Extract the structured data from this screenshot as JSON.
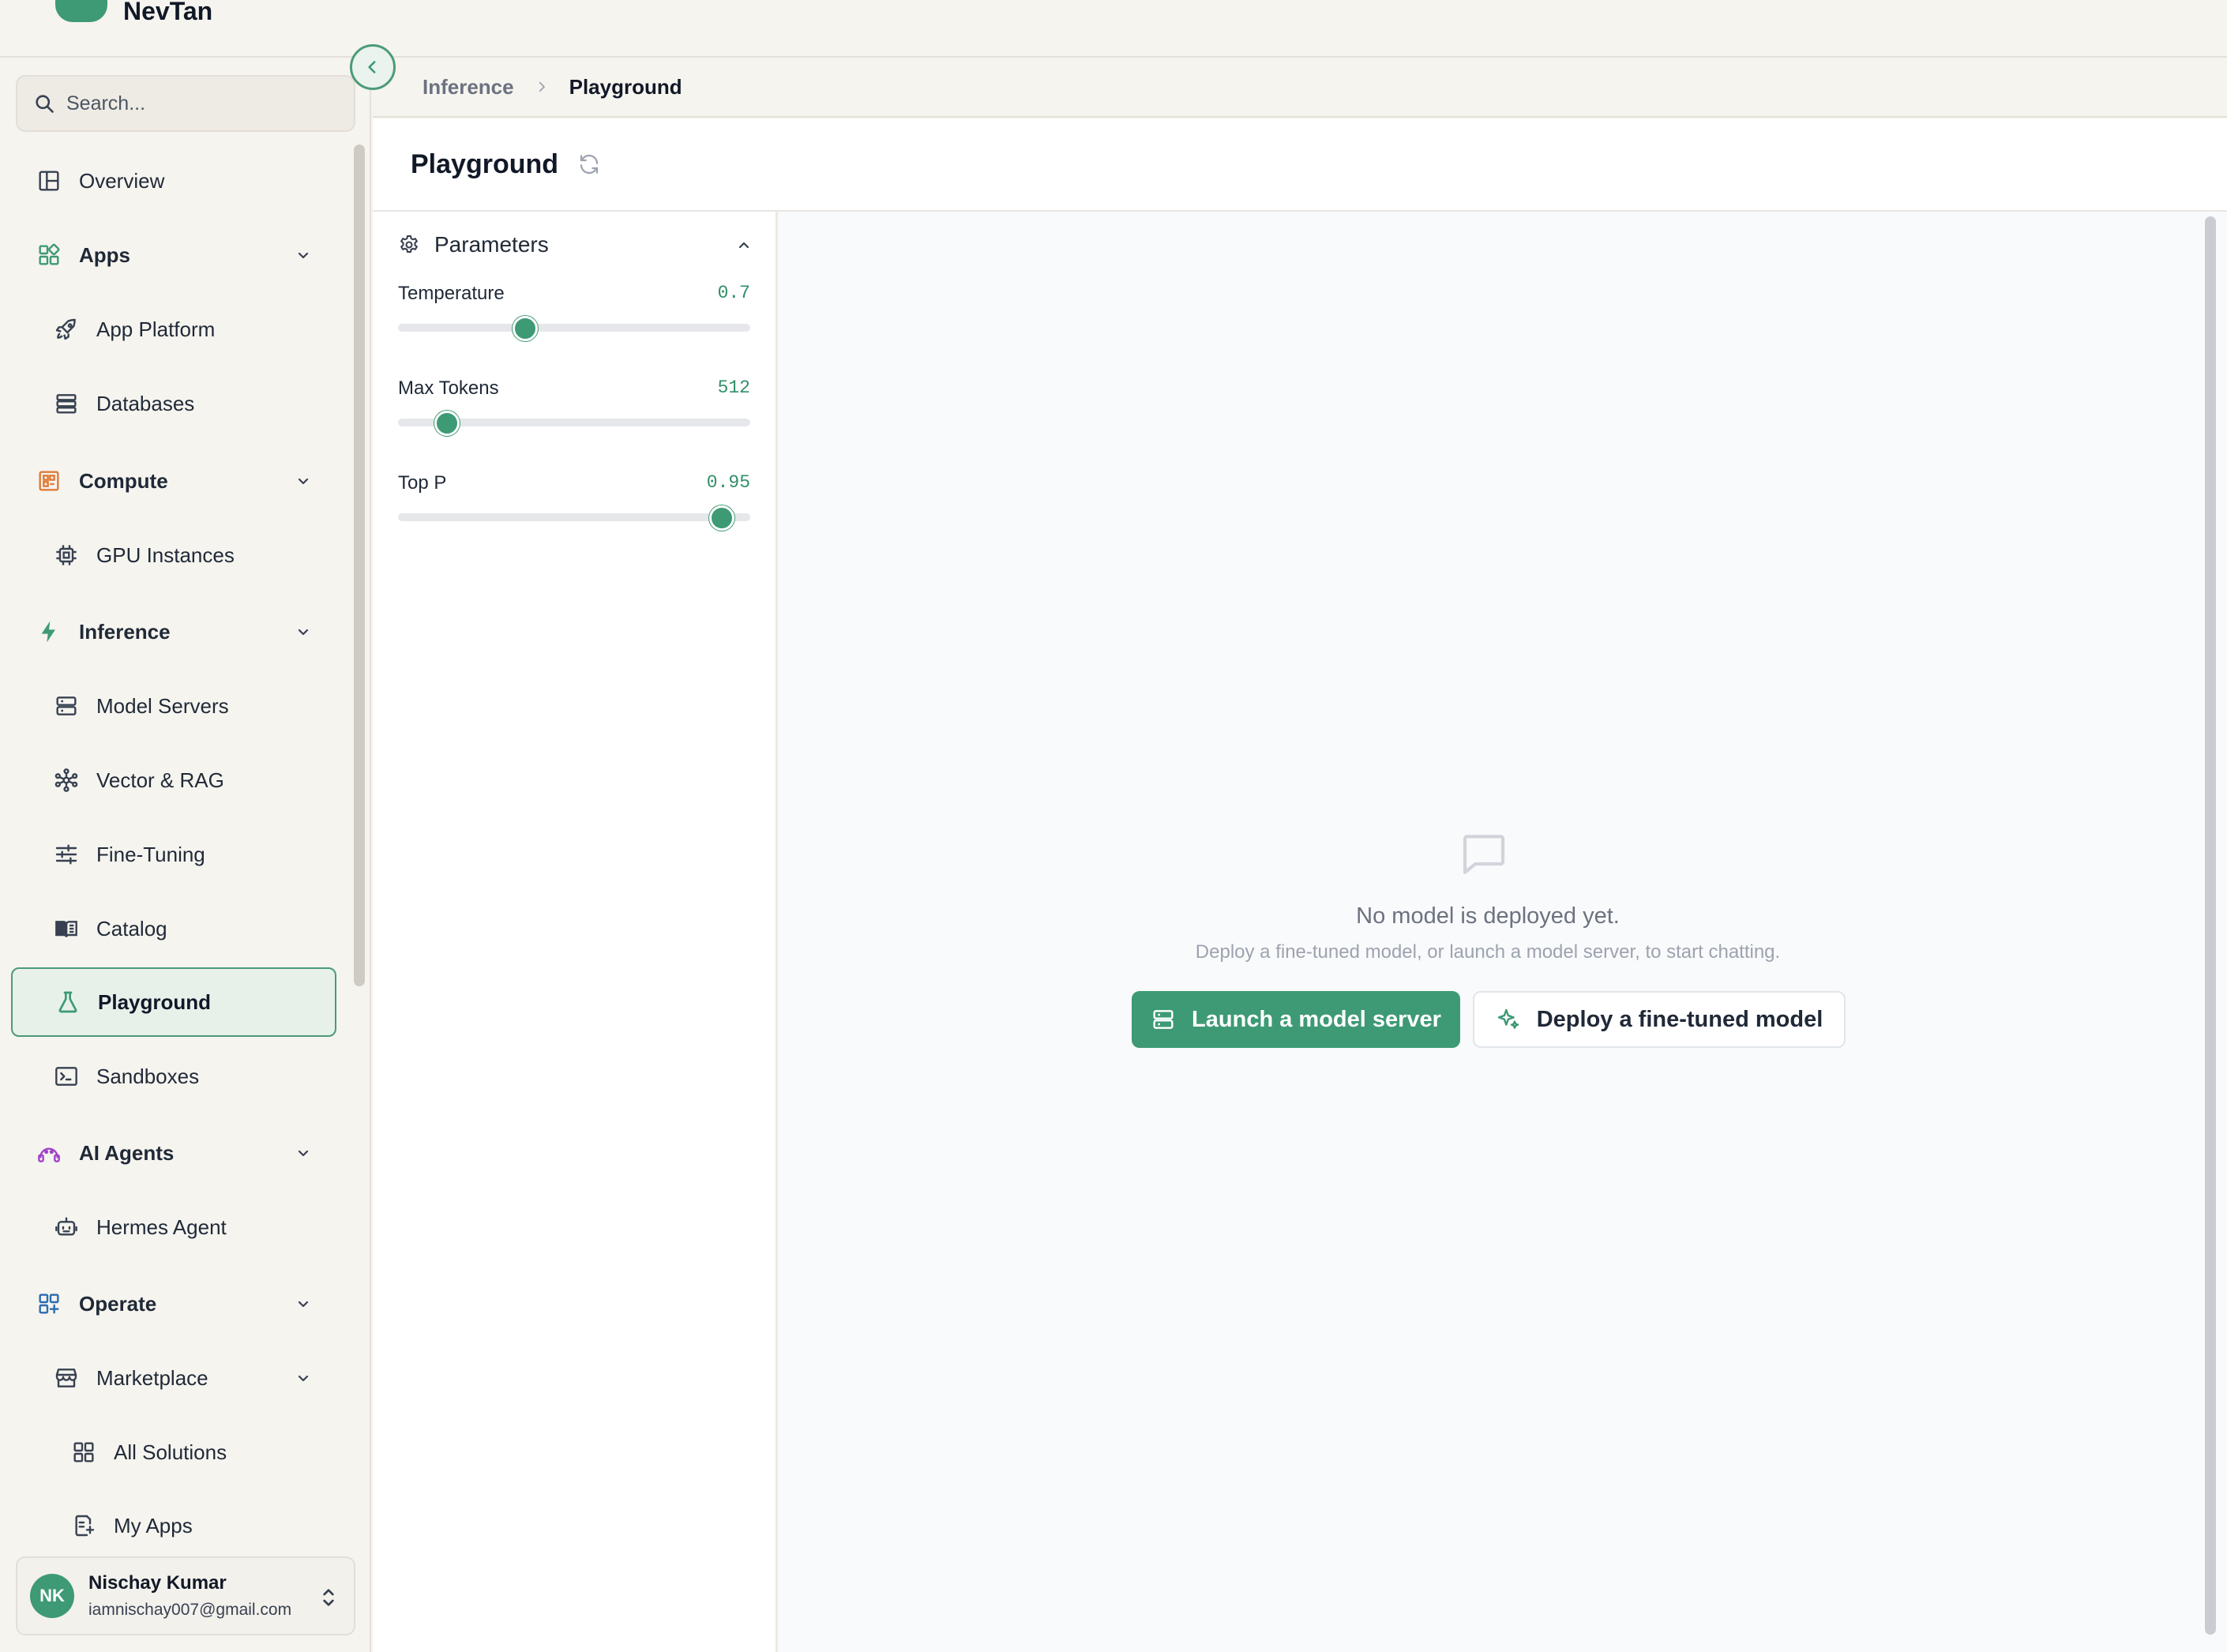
{
  "brand": {
    "name": "NevTan"
  },
  "search": {
    "placeholder": "Search..."
  },
  "sidebar": {
    "items": [
      {
        "label": "Overview",
        "icon": "layout-icon"
      },
      {
        "label": "Apps",
        "icon": "apps-icon"
      },
      {
        "label": "App Platform",
        "icon": "rocket-icon"
      },
      {
        "label": "Databases",
        "icon": "database-icon"
      },
      {
        "label": "Compute",
        "icon": "compute-icon"
      },
      {
        "label": "GPU Instances",
        "icon": "cpu-icon"
      },
      {
        "label": "Inference",
        "icon": "lightning-icon"
      },
      {
        "label": "Model Servers",
        "icon": "server-icon"
      },
      {
        "label": "Vector & RAG",
        "icon": "network-icon"
      },
      {
        "label": "Fine-Tuning",
        "icon": "sliders-icon"
      },
      {
        "label": "Catalog",
        "icon": "book-icon"
      },
      {
        "label": "Playground",
        "icon": "flask-icon"
      },
      {
        "label": "Sandboxes",
        "icon": "terminal-icon"
      },
      {
        "label": "AI Agents",
        "icon": "agent-icon"
      },
      {
        "label": "Hermes Agent",
        "icon": "bot-icon"
      },
      {
        "label": "Operate",
        "icon": "grid-plus-icon"
      },
      {
        "label": "Marketplace",
        "icon": "store-icon"
      },
      {
        "label": "All Solutions",
        "icon": "grid-icon"
      },
      {
        "label": "My Apps",
        "icon": "app-file-icon"
      }
    ],
    "active": "Playground"
  },
  "user": {
    "initials": "NK",
    "name": "Nischay Kumar",
    "email": "iamnischay007@gmail.com"
  },
  "breadcrumb": {
    "parent": "Inference",
    "current": "Playground"
  },
  "page": {
    "title": "Playground"
  },
  "parameters": {
    "title": "Parameters",
    "items": [
      {
        "label": "Temperature",
        "value": "0.7",
        "fraction": 0.36
      },
      {
        "label": "Max Tokens",
        "value": "512",
        "fraction": 0.14
      },
      {
        "label": "Top P",
        "value": "0.95",
        "fraction": 0.92
      }
    ]
  },
  "empty_state": {
    "title": "No model is deployed yet.",
    "subtitle": "Deploy a fine-tuned model, or launch a model server, to start chatting.",
    "primary_button": "Launch a model server",
    "secondary_button": "Deploy a fine-tuned model"
  },
  "colors": {
    "accent": "#3d9a74",
    "accent_light": "#e7f1ea",
    "sidebar_bg": "#f6f4ef",
    "compute_orange": "#e07b39",
    "agents_purple": "#a142c9",
    "operate_blue": "#2b6cb0"
  }
}
